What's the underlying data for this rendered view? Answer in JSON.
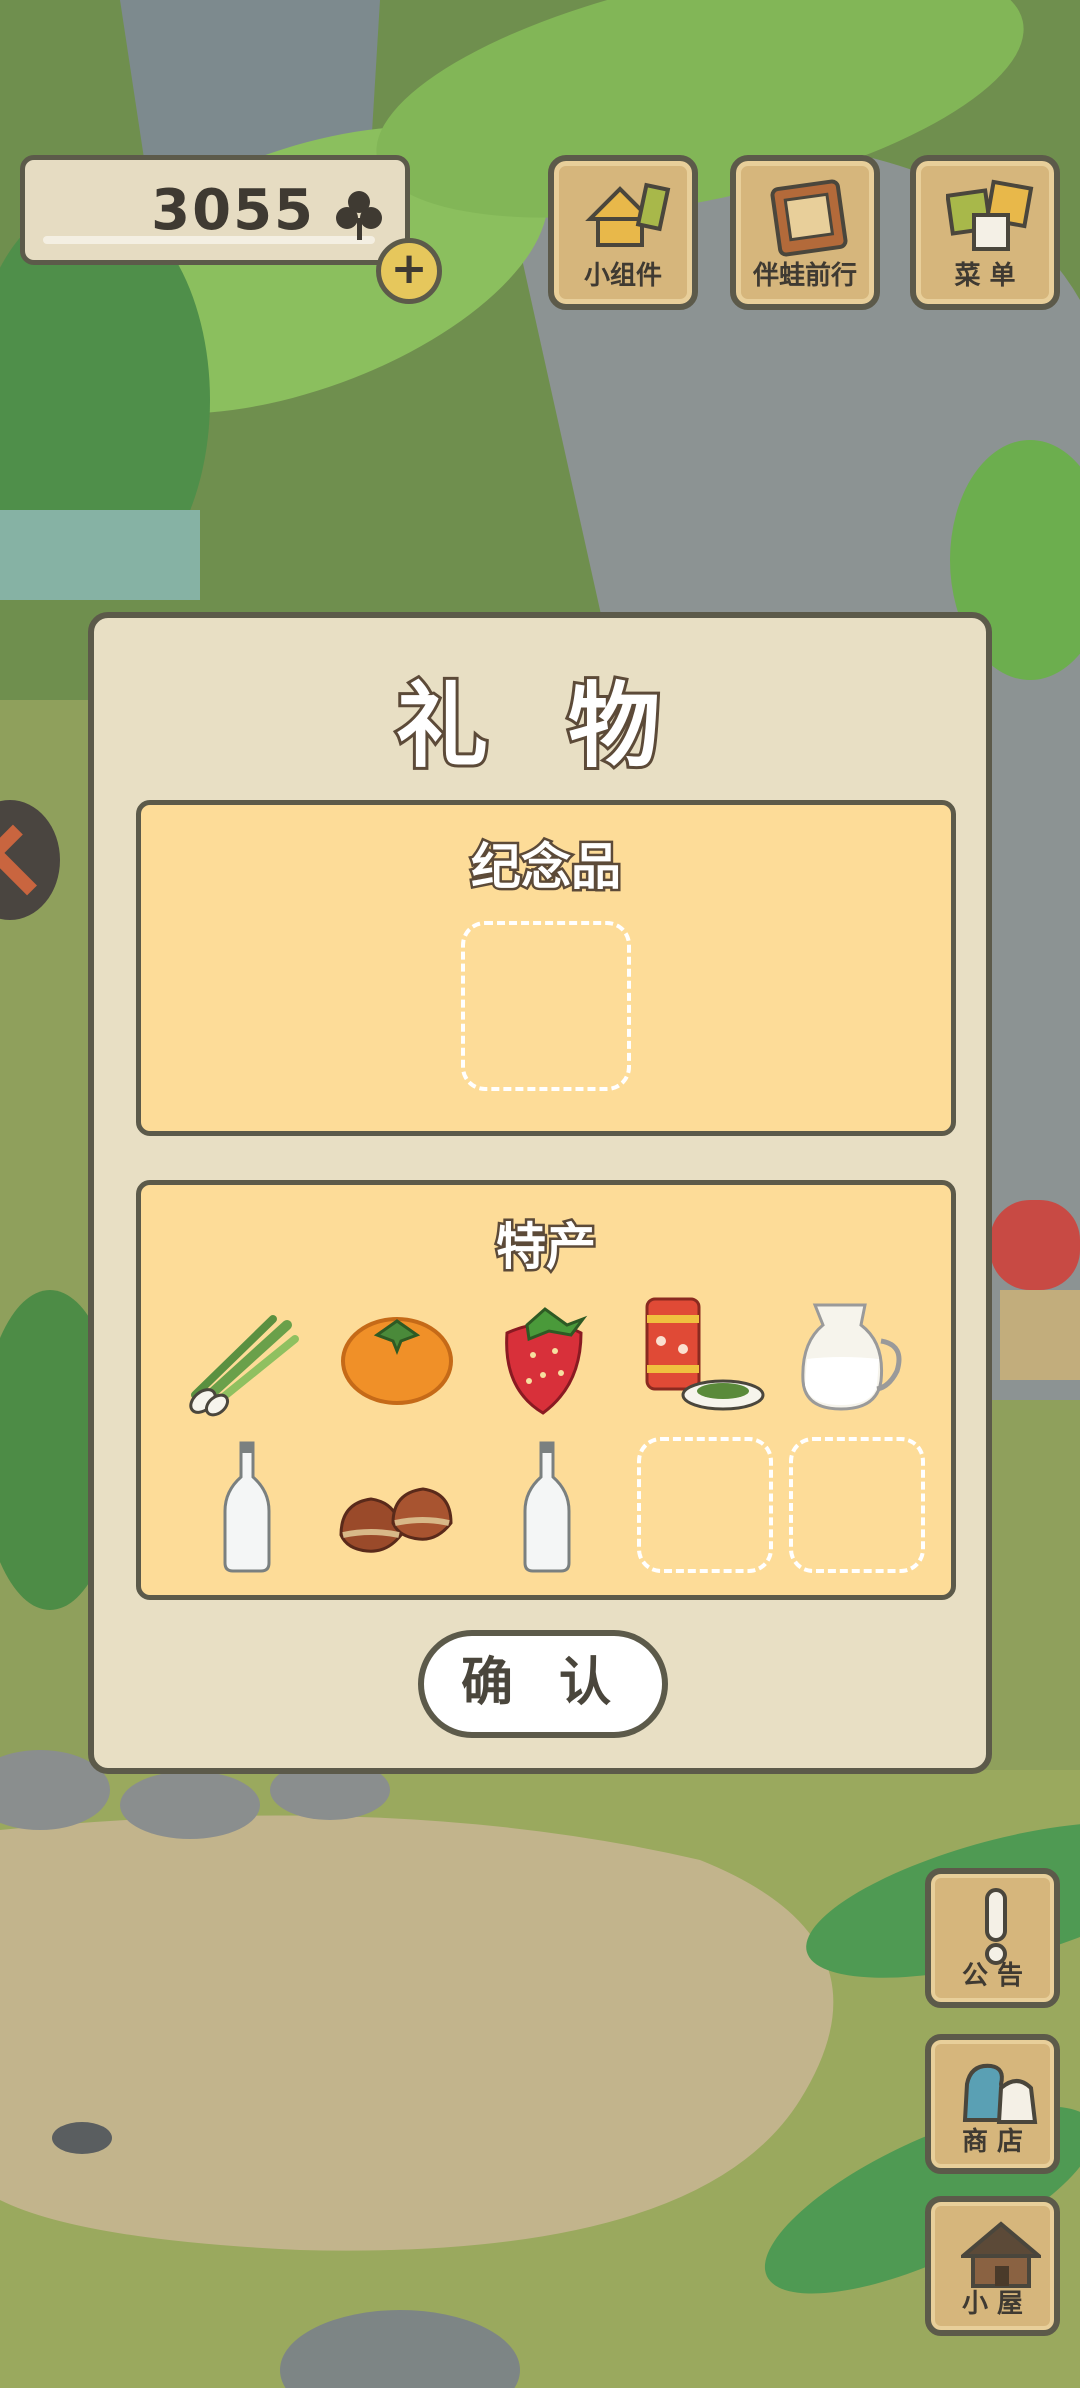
{
  "status": {
    "clover_count": "3055",
    "add_label": "+"
  },
  "top_menu": [
    {
      "label": "小组件",
      "icon": "widget-icon"
    },
    {
      "label": "伴蛙前行",
      "icon": "journey-book-icon"
    },
    {
      "label": "菜 单",
      "icon": "menu-cards-icon"
    }
  ],
  "side_menu": [
    {
      "label": "公 告",
      "icon": "exclamation-icon"
    },
    {
      "label": "商 店",
      "icon": "shop-bags-icon"
    },
    {
      "label": "小 屋",
      "icon": "house-icon"
    }
  ],
  "dialog": {
    "title": "礼 物",
    "souvenir": {
      "title": "纪念品"
    },
    "specialty": {
      "title": "特产",
      "items": [
        {
          "name": "green-onion",
          "icon": "green-onion-icon"
        },
        {
          "name": "persimmon",
          "icon": "persimmon-icon"
        },
        {
          "name": "strawberry",
          "icon": "strawberry-icon"
        },
        {
          "name": "tea-tin",
          "icon": "tea-tin-icon"
        },
        {
          "name": "milk-jug",
          "icon": "milk-jug-icon"
        },
        {
          "name": "glass-bottle",
          "icon": "bottle-icon"
        },
        {
          "name": "chestnuts",
          "icon": "chestnut-icon"
        },
        {
          "name": "glass-bottle",
          "icon": "bottle-icon"
        }
      ]
    },
    "confirm_label": "确 认"
  },
  "colors": {
    "dialog_bg": "#e8dfc4",
    "panel_bg": "#fddc98",
    "outline": "#5c5a4a",
    "button_wood": "#d6b67c"
  }
}
